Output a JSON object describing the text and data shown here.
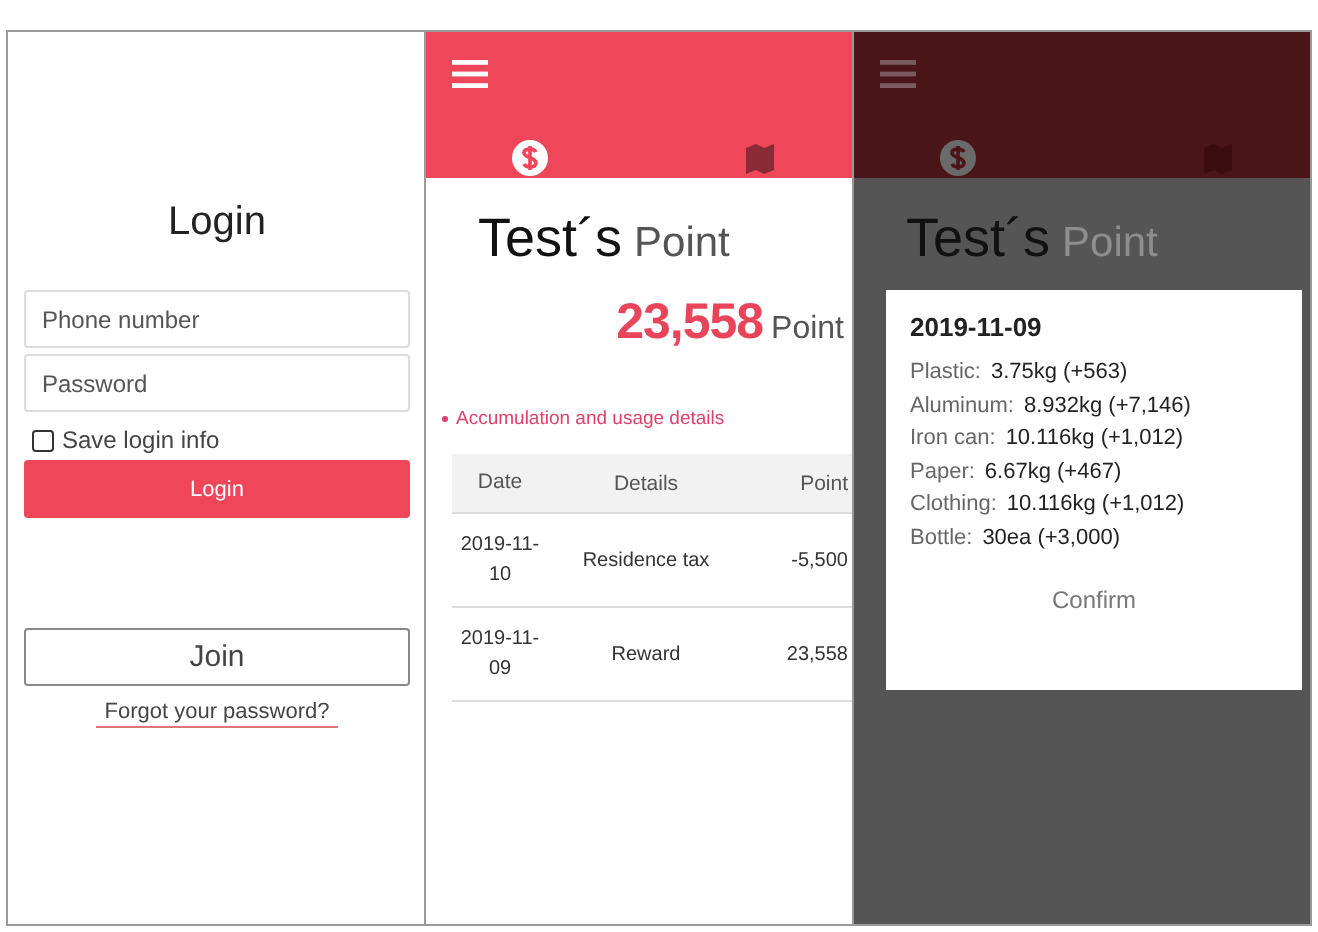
{
  "login": {
    "title": "Login",
    "fields": [
      {
        "placeholder": "Phone number"
      },
      {
        "placeholder": "Password"
      }
    ],
    "remember": {
      "label": "Save login info",
      "checked": false
    },
    "login_button": "Login",
    "join_button": "Join",
    "forgot_link": "Forgot your password?"
  },
  "points": {
    "tabs": [
      {
        "kind": "coin",
        "selected": true
      },
      {
        "kind": "map",
        "selected": false
      }
    ],
    "title_name": "Test´s",
    "title_suffix": "Point",
    "total": "23,558",
    "unit": "Point",
    "section": "Accumulation and usage details",
    "table": {
      "columns": [
        "Date",
        "Details",
        "Point"
      ],
      "rows": [
        {
          "date": "2019-11-10",
          "details": "Residence tax",
          "point": "-5,500"
        },
        {
          "date": "2019-11-09",
          "details": "Reward",
          "point": "23,558"
        }
      ]
    }
  },
  "overlay": {
    "tabs": [
      {
        "kind": "coin",
        "selected": true
      },
      {
        "kind": "map",
        "selected": false
      }
    ],
    "title_name": "Test´s",
    "title_suffix": "Point",
    "dialog": {
      "date": "2019-11-09",
      "items": [
        {
          "label": "Plastic:",
          "value": "3.75kg (+563)"
        },
        {
          "label": "Aluminum:",
          "value": "8.932kg (+7,146)"
        },
        {
          "label": "Iron can:",
          "value": "10.116kg (+1,012)"
        },
        {
          "label": "Paper:",
          "value": "6.67kg (+467)"
        },
        {
          "label": "Clothing:",
          "value": "10.116kg (+1,012)"
        },
        {
          "label": "Bottle:",
          "value": "30ea (+3,000)"
        }
      ],
      "confirm": "Confirm"
    }
  }
}
